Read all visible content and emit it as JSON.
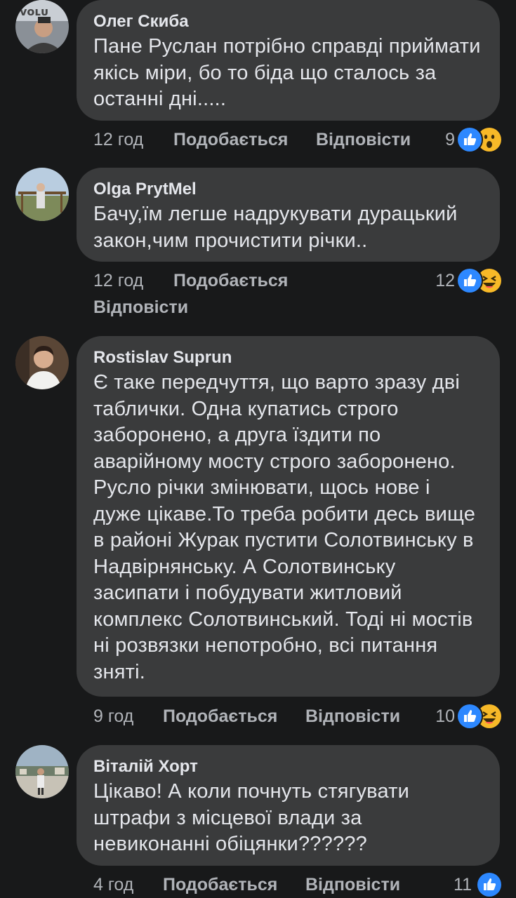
{
  "comments": [
    {
      "author": "Олег Скиба",
      "text": "Пане Руслан потрібно справді приймати якісь міри, бо то біда що сталось за останні дні.....",
      "time": "12 год",
      "like_label": "Подобається",
      "reply_label": "Відповісти",
      "reaction_count": "9",
      "reactions": [
        "like-icon",
        "wow-icon"
      ]
    },
    {
      "author": "Olga PrytMel",
      "text": "Бачу,їм легше надрукувати дурацький закон,чим прочистити річки..",
      "time": "12 год",
      "like_label": "Подобається",
      "reply_label": "Відповісти",
      "reaction_count": "12",
      "reactions": [
        "like-icon",
        "haha-icon"
      ]
    },
    {
      "author": "Rostislav Suprun",
      "text": "Є таке передчуття, що варто зразу дві таблички. Одна купатись строго заборонено, а друга їздити по аварійному мосту строго заборонено. Русло річки змінювати, щось нове і дуже цікаве.То треба робити десь вище в районі Журак пустити Солотвинську в Надвірнянську. А Солотвинську засипати і побудувати житловий комплекс Солотвинський. Тоді ні мостів ні розвязки непотробно, всі питання зняті.",
      "time": "9 год",
      "like_label": "Подобається",
      "reply_label": "Відповісти",
      "reaction_count": "10",
      "reactions": [
        "like-icon",
        "haha-icon"
      ]
    },
    {
      "author": "Віталій Хорт",
      "text": "Цікаво! А коли почнуть стягувати штрафи з місцевої влади за невиконанні обіцянки??????",
      "time": "4 год",
      "like_label": "Подобається",
      "reply_label": "Відповісти",
      "reaction_count": "11",
      "reactions": [
        "like-icon"
      ]
    }
  ],
  "colors": {
    "background": "#18191a",
    "bubble": "#3a3b3c",
    "text": "#e4e6eb",
    "secondary": "#b0b3b8",
    "like_blue": "#2d88ff",
    "emoji_yellow": "#f7b928"
  }
}
